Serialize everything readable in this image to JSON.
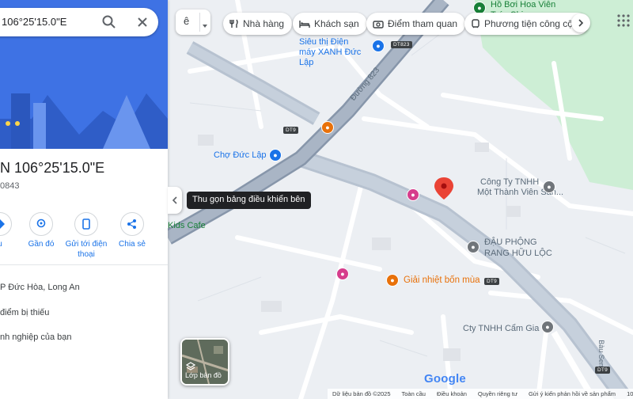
{
  "search": {
    "query": "106°25'15.0\"E"
  },
  "place": {
    "title": "N 106°25'15.0\"E",
    "subtitle": "0843"
  },
  "actions": [
    {
      "label": "u"
    },
    {
      "label": "Gần đó"
    },
    {
      "label": "Gửi tới điện thoại"
    },
    {
      "label": "Chia sẻ"
    }
  ],
  "info_rows": [
    {
      "text": "P Đức Hòa, Long An"
    },
    {
      "text": "điểm bị thiếu"
    },
    {
      "text": "nh nghiệp của bạn"
    }
  ],
  "tooltip": "Thu gọn bảng điều khiển bên",
  "lang_button": {
    "label": "ê"
  },
  "chips": [
    {
      "label": "Nhà hàng",
      "icon": "restaurant-icon"
    },
    {
      "label": "Khách sạn",
      "icon": "hotel-icon"
    },
    {
      "label": "Điểm tham quan",
      "icon": "camera-icon"
    },
    {
      "label": "Phương tiện công cộ...",
      "icon": "transit-icon"
    }
  ],
  "layer_button": {
    "label": "Lớp bản đồ"
  },
  "map_labels": {
    "store": "Siêu thị Điện máy XANH Đức Lập",
    "market": "Chợ Đức Lập",
    "pool": "Hồ Bơi Hoa Viên Trúc Chi",
    "company1_line1": "Công Ty TNHH",
    "company1_line2": "Một Thành Viên Sản...",
    "peanut_line1": "ĐẬU PHỘNG",
    "peanut_line2": "RANG HỮU LỘC",
    "drink": "Giải nhiệt bốn mùa",
    "company2": "Cty TNHH Cẩm Gia",
    "cafe": "Kids Cafe",
    "road823": "Đường 823",
    "bausen": "Bàu Sen",
    "dt823": "DT823",
    "dt9": "DT9"
  },
  "logo": "Google",
  "footer": [
    "Dữ liệu bản đồ ©2025",
    "Toàn cầu",
    "Điều khoản",
    "Quyền riêng tư",
    "Gửi ý kiến phản hồi về sản phẩm",
    "10"
  ],
  "colors": {
    "accent": "#1a73e8",
    "panel_hero": "#3b6fe0",
    "road": "#aab6c6",
    "park": "#c9ecd2",
    "pin": "#ea4335"
  }
}
